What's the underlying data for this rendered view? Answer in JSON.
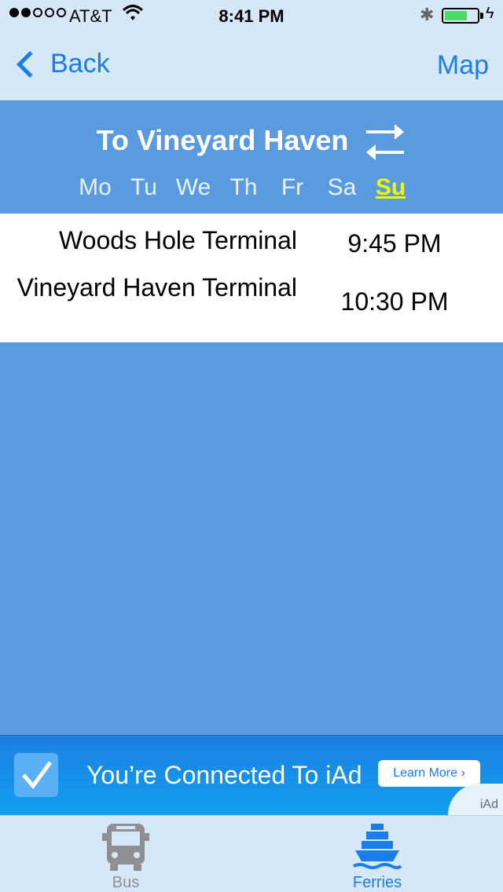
{
  "status_bar": {
    "carrier": "AT&T",
    "time": "8:41 PM",
    "signal_dots_filled": 2,
    "signal_dots_total": 5,
    "battery_level": 0.7
  },
  "nav": {
    "back_label": "Back",
    "map_label": "Map"
  },
  "header": {
    "direction_title": "To Vineyard Haven",
    "days": [
      "Mo",
      "Tu",
      "We",
      "Th",
      "Fr",
      "Sa",
      "Su"
    ],
    "active_day": "Su"
  },
  "schedule": [
    {
      "stop": "Woods Hole Terminal",
      "time": "9:45 PM"
    },
    {
      "stop": "Vineyard Haven Terminal",
      "time": "10:30 PM"
    }
  ],
  "ad": {
    "text": "You’re Connected To iAd",
    "learn_more": "Learn More ›",
    "badge": "iAd"
  },
  "tabs": [
    {
      "label": "Bus",
      "icon": "bus-icon",
      "selected": false
    },
    {
      "label": "Ferries",
      "icon": "ferry-icon",
      "selected": true
    }
  ],
  "colors": {
    "accent": "#1a7ee8",
    "background": "#5a9be0",
    "active_day": "#f4f400",
    "bar_bg": "#d6e8f8"
  }
}
